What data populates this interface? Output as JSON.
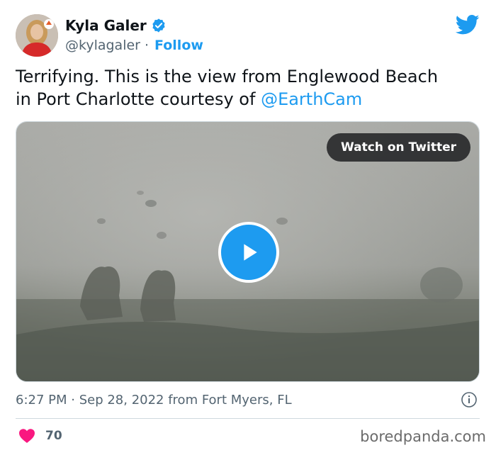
{
  "author": {
    "name": "Kyla Galer",
    "handle": "@kylagaler",
    "separator": "·",
    "follow_label": "Follow"
  },
  "tweet": {
    "text": "Terrifying. This is the view from Englewood Beach\nin Port Charlotte courtesy of ",
    "mention": "@EarthCam",
    "timestamp": "6:27 PM · Sep 28, 2022 from Fort Myers, FL",
    "like_count": "70"
  },
  "media": {
    "watch_label": "Watch on Twitter"
  },
  "watermark": "boredpanda.com",
  "icons": {
    "brand": "twitter-bird-icon",
    "verified": "verified-badge-icon",
    "play": "play-icon",
    "info": "info-icon",
    "like": "heart-icon"
  },
  "colors": {
    "accent": "#1d9bf0",
    "like": "#f91880",
    "text": "#0f1419",
    "muted": "#536471"
  }
}
